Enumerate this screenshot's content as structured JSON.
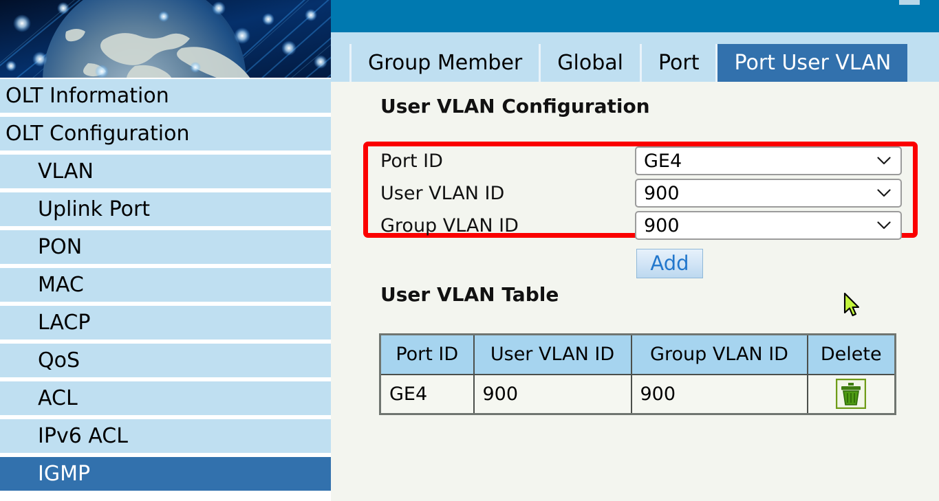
{
  "header": {
    "bar_color": "#0079b0",
    "banner_icon": "globe-network-banner"
  },
  "sidebar": {
    "items": [
      {
        "label": "OLT Information",
        "level": "top",
        "active": false
      },
      {
        "label": "OLT Configuration",
        "level": "top",
        "active": false
      },
      {
        "label": "VLAN",
        "level": "child",
        "active": false
      },
      {
        "label": "Uplink Port",
        "level": "child",
        "active": false
      },
      {
        "label": "PON",
        "level": "child",
        "active": false
      },
      {
        "label": "MAC",
        "level": "child",
        "active": false
      },
      {
        "label": "LACP",
        "level": "child",
        "active": false
      },
      {
        "label": "QoS",
        "level": "child",
        "active": false
      },
      {
        "label": "ACL",
        "level": "child",
        "active": false
      },
      {
        "label": "IPv6 ACL",
        "level": "child",
        "active": false
      },
      {
        "label": "IGMP",
        "level": "child",
        "active": true
      }
    ],
    "active_color": "#3271ad",
    "item_color": "#bfdff1"
  },
  "tabs": [
    {
      "label": "Group Member",
      "active": false
    },
    {
      "label": "Global",
      "active": false
    },
    {
      "label": "Port",
      "active": false
    },
    {
      "label": "Port User VLAN",
      "active": true
    }
  ],
  "config": {
    "title": "User VLAN Configuration",
    "highlight_color": "#fb0000",
    "fields": [
      {
        "label": "Port ID",
        "value": "GE4",
        "icon": "chevron-down-icon"
      },
      {
        "label": "User VLAN ID",
        "value": "900",
        "icon": "chevron-down-icon"
      },
      {
        "label": "Group VLAN ID",
        "value": "900",
        "icon": "chevron-down-icon"
      }
    ],
    "add_label": "Add"
  },
  "table": {
    "title": "User VLAN Table",
    "columns": [
      "Port ID",
      "User VLAN ID",
      "Group VLAN ID",
      "Delete"
    ],
    "rows": [
      {
        "port_id": "GE4",
        "user_vlan_id": "900",
        "group_vlan_id": "900",
        "delete_icon": "trash-icon"
      }
    ],
    "header_color": "#a6d4ef"
  },
  "cursor": {
    "icon": "arrow-pointer-cursor",
    "color": "#c3f53c"
  }
}
